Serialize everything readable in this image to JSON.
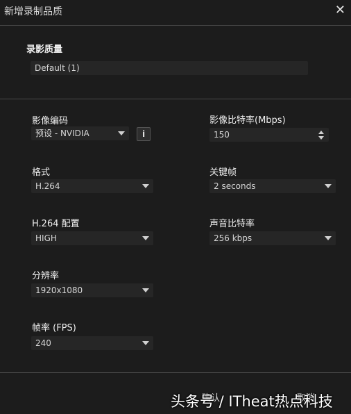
{
  "dialog": {
    "title": "新增录制品质",
    "quality_label": "录影质量",
    "quality_value": "Default (1)"
  },
  "left": {
    "encoder": {
      "label": "影像编码",
      "value": "预设 - NVIDIA",
      "info": "i"
    },
    "format": {
      "label": "格式",
      "value": "H.264"
    },
    "profile": {
      "label": "H.264 配置",
      "value": "HIGH"
    },
    "resolution": {
      "label": "分辨率",
      "value": "1920x1080"
    },
    "framerate": {
      "label": "帧率 (FPS)",
      "value": "240"
    }
  },
  "right": {
    "bitrate": {
      "label": "影像比特率(Mbps)",
      "value": "150"
    },
    "keyframe": {
      "label": "关键帧",
      "value": "2 seconds"
    },
    "audio_bitrate": {
      "label": "声音比特率",
      "value": "256 kbps"
    }
  },
  "footer": {
    "confirm": "确认",
    "cancel": "取消"
  },
  "watermark": "头条号 / ITheat热点科技",
  "icons": [
    "close-icon",
    "info-icon",
    "chevron-down-icon",
    "spinner-icon"
  ]
}
